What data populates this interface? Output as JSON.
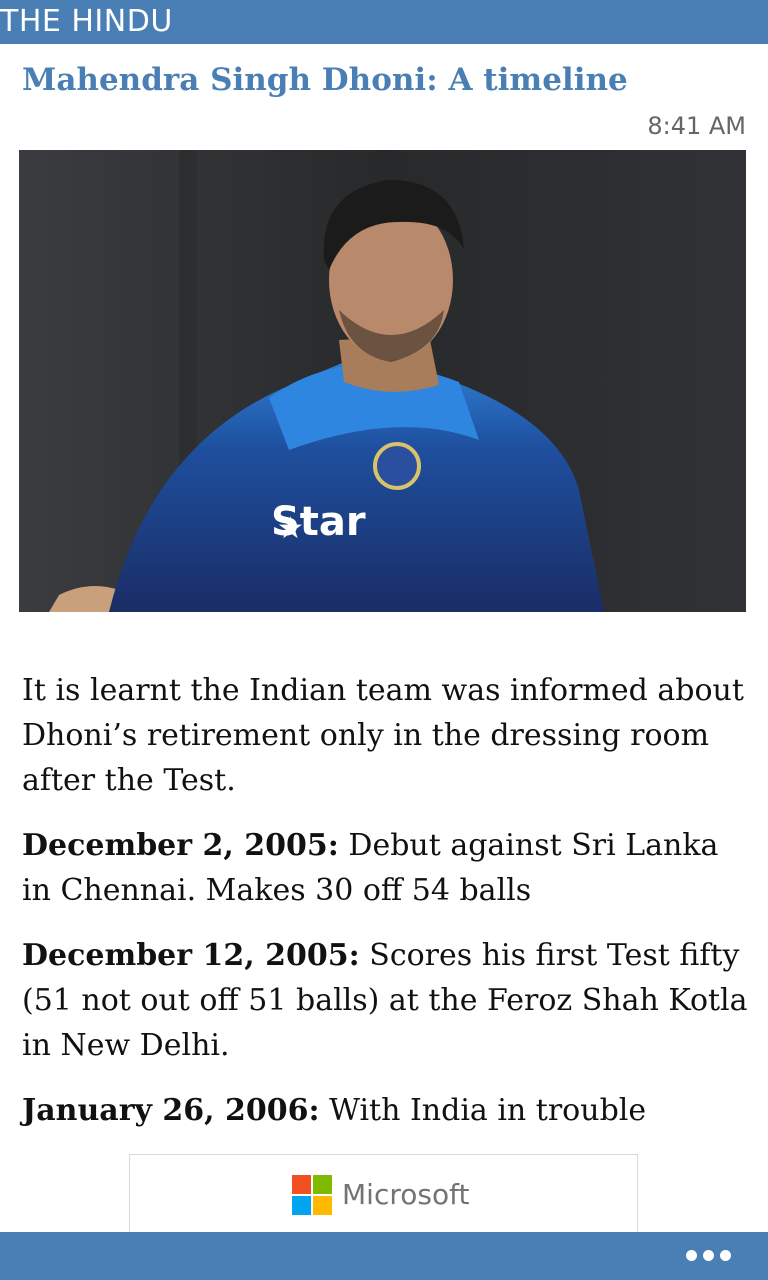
{
  "header": {
    "app_name": "THE HINDU"
  },
  "article": {
    "title": "Mahendra Singh Dhoni: A timeline",
    "time": "8:41 AM",
    "photo": {
      "jersey_text": "Star"
    },
    "intro": "It is learnt the Indian team was informed about Dhoni’s retirement only in the dressing room after the Test.",
    "entries": [
      {
        "date": "December 2, 2005:",
        "text": " Debut against Sri Lanka in Chennai. Makes 30 off 54 balls"
      },
      {
        "date": "December 12, 2005:",
        "text": " Scores his first Test fifty (51 not out off 51 balls) at the Feroz Shah Kotla in New Delhi."
      },
      {
        "date": "January 26, 2006:",
        "text": " With India in trouble"
      }
    ]
  },
  "ad": {
    "brand": "Microsoft",
    "logo_colors": [
      "#f25022",
      "#7fba00",
      "#00a4ef",
      "#ffb900"
    ]
  },
  "appbar": {
    "more_icon": "ellipsis-icon"
  },
  "colors": {
    "accent": "#4a7fb5"
  }
}
